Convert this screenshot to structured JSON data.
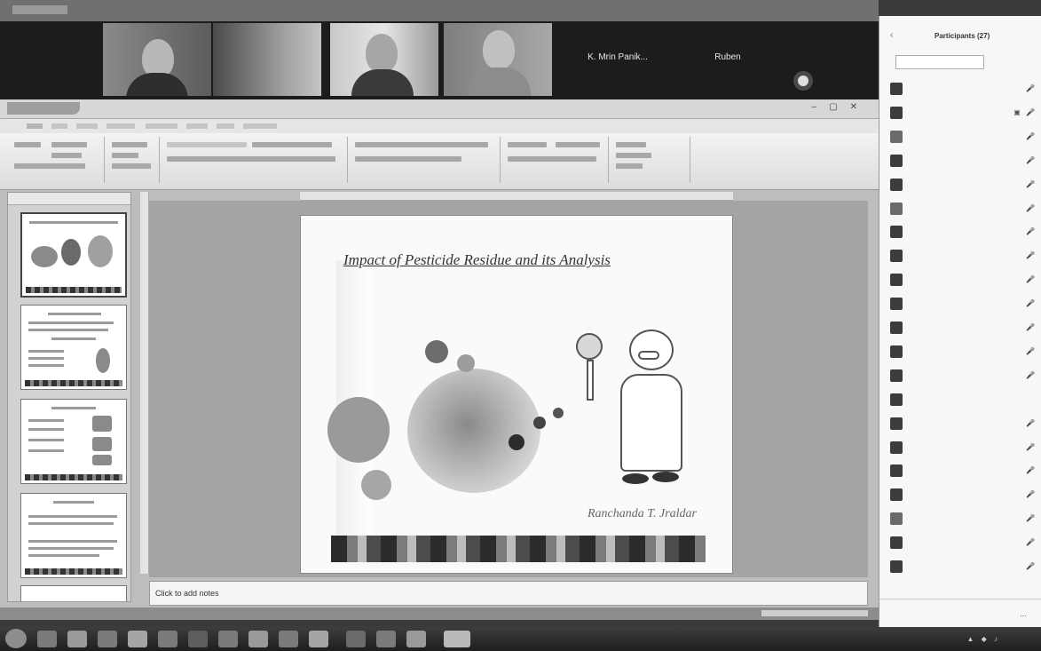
{
  "meeting": {
    "participants_tiles": [
      {
        "name": ""
      },
      {
        "name": ""
      },
      {
        "name": ""
      },
      {
        "name": ""
      }
    ],
    "name_tiles": [
      "K. Mrin Panik...",
      "Ruben"
    ]
  },
  "ppt": {
    "window_title": "",
    "slide": {
      "title": "Impact of Pesticide Residue and its Analysis",
      "author": "Ranchanda T. Jraldar"
    },
    "notes_placeholder": "Click to add notes",
    "status": ""
  },
  "panel": {
    "title": "Participants (27)",
    "search_placeholder": "",
    "participants": [
      {
        "name": "",
        "avatar_color": "#3c3c3c",
        "icons": "🎤"
      },
      {
        "name": "",
        "avatar_color": "#3c3c3c",
        "icons": "▣ 🎤"
      },
      {
        "name": "",
        "avatar_color": "#6a6a6a",
        "icons": "🎤"
      },
      {
        "name": "",
        "avatar_color": "#3c3c3c",
        "icons": "🎤"
      },
      {
        "name": "",
        "avatar_color": "#3c3c3c",
        "icons": "🎤"
      },
      {
        "name": "",
        "avatar_color": "#6a6a6a",
        "icons": "🎤"
      },
      {
        "name": "",
        "avatar_color": "#3c3c3c",
        "icons": "🎤"
      },
      {
        "name": "",
        "avatar_color": "#3c3c3c",
        "icons": "🎤"
      },
      {
        "name": "",
        "avatar_color": "#3c3c3c",
        "icons": "🎤"
      },
      {
        "name": "",
        "avatar_color": "#3c3c3c",
        "icons": "🎤"
      },
      {
        "name": "",
        "avatar_color": "#3c3c3c",
        "icons": "🎤"
      },
      {
        "name": "",
        "avatar_color": "#3c3c3c",
        "icons": "🎤"
      },
      {
        "name": "",
        "avatar_color": "#3c3c3c",
        "icons": "🎤"
      },
      {
        "name": "",
        "avatar_color": "#3c3c3c",
        "icons": ""
      },
      {
        "name": "",
        "avatar_color": "#3c3c3c",
        "icons": "🎤"
      },
      {
        "name": "",
        "avatar_color": "#3c3c3c",
        "icons": "🎤"
      },
      {
        "name": "",
        "avatar_color": "#3c3c3c",
        "icons": "🎤"
      },
      {
        "name": "",
        "avatar_color": "#3c3c3c",
        "icons": "🎤"
      },
      {
        "name": "",
        "avatar_color": "#6a6a6a",
        "icons": "🎤"
      },
      {
        "name": "",
        "avatar_color": "#3c3c3c",
        "icons": "🎤"
      },
      {
        "name": "",
        "avatar_color": "#3c3c3c",
        "icons": "🎤"
      }
    ],
    "footer": {
      "left": "",
      "middle": ""
    }
  },
  "taskbar": {
    "time": "",
    "date": ""
  }
}
